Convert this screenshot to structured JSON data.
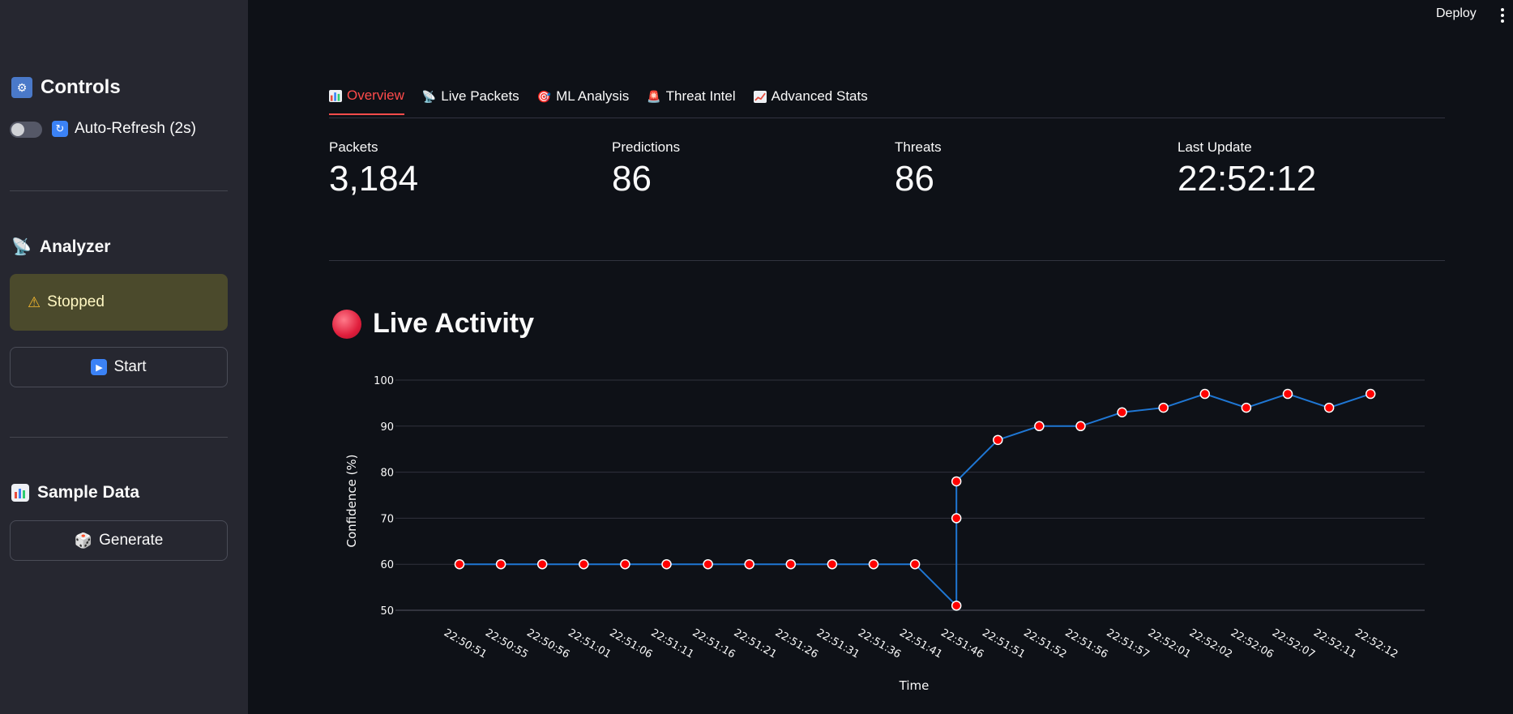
{
  "sidebar": {
    "controls_heading": "Controls",
    "controls_icon": "control-knobs-icon",
    "auto_refresh_label": "Auto-Refresh (2s)",
    "auto_refresh_on": false,
    "analyzer_heading": "Analyzer",
    "analyzer_status": "Stopped",
    "start_button": "Start",
    "sample_heading": "Sample Data",
    "generate_button": "Generate",
    "status_color": "#4b4a2c"
  },
  "topbar": {
    "deploy_label": "Deploy"
  },
  "tabs": [
    {
      "label": "Overview",
      "icon": "bar-chart-icon",
      "active": true
    },
    {
      "label": "Live Packets",
      "icon": "satellite-icon",
      "active": false
    },
    {
      "label": "ML Analysis",
      "icon": "target-icon",
      "active": false
    },
    {
      "label": "Threat Intel",
      "icon": "siren-icon",
      "active": false
    },
    {
      "label": "Advanced Stats",
      "icon": "chart-increasing-icon",
      "active": false
    }
  ],
  "metrics": [
    {
      "label": "Packets",
      "value": "3,184"
    },
    {
      "label": "Predictions",
      "value": "86"
    },
    {
      "label": "Threats",
      "value": "86"
    },
    {
      "label": "Last Update",
      "value": "22:52:12"
    }
  ],
  "section_title": "Live Activity",
  "colors": {
    "accent": "#ff4b4b",
    "line": "#1f77d4",
    "marker": "#ff0000"
  },
  "chart_data": {
    "type": "line",
    "xlabel": "Time",
    "ylabel": "Confidence (%)",
    "ylim": [
      50,
      100
    ],
    "yticks": [
      50,
      60,
      70,
      80,
      90,
      100
    ],
    "x_categories": [
      "22:50:51",
      "22:50:55",
      "22:50:56",
      "22:51:01",
      "22:51:06",
      "22:51:11",
      "22:51:16",
      "22:51:21",
      "22:51:26",
      "22:51:31",
      "22:51:36",
      "22:51:41",
      "22:51:46",
      "22:51:51",
      "22:51:52",
      "22:51:56",
      "22:51:57",
      "22:52:01",
      "22:52:02",
      "22:52:06",
      "22:52:07",
      "22:52:11",
      "22:52:12"
    ],
    "points": [
      {
        "x": "22:50:51",
        "y": 60
      },
      {
        "x": "22:50:55",
        "y": 60
      },
      {
        "x": "22:50:56",
        "y": 60
      },
      {
        "x": "22:51:01",
        "y": 60
      },
      {
        "x": "22:51:06",
        "y": 60
      },
      {
        "x": "22:51:11",
        "y": 60
      },
      {
        "x": "22:51:16",
        "y": 60
      },
      {
        "x": "22:51:21",
        "y": 60
      },
      {
        "x": "22:51:26",
        "y": 60
      },
      {
        "x": "22:51:31",
        "y": 60
      },
      {
        "x": "22:51:36",
        "y": 60
      },
      {
        "x": "22:51:41",
        "y": 60
      },
      {
        "x": "22:51:46",
        "y": 51
      },
      {
        "x": "22:51:46",
        "y": 70
      },
      {
        "x": "22:51:46",
        "y": 78
      },
      {
        "x": "22:51:51",
        "y": 87
      },
      {
        "x": "22:51:52",
        "y": 90
      },
      {
        "x": "22:51:56",
        "y": 90
      },
      {
        "x": "22:51:57",
        "y": 93
      },
      {
        "x": "22:52:01",
        "y": 94
      },
      {
        "x": "22:52:02",
        "y": 97
      },
      {
        "x": "22:52:06",
        "y": 94
      },
      {
        "x": "22:52:07",
        "y": 97
      },
      {
        "x": "22:52:11",
        "y": 94
      },
      {
        "x": "22:52:12",
        "y": 97
      }
    ],
    "grid": true
  }
}
